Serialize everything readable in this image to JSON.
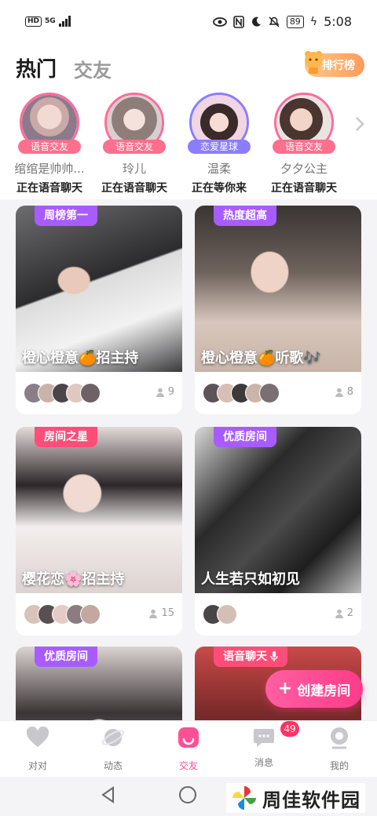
{
  "status_bar": {
    "hd": "HD",
    "network": "5G",
    "battery": "89",
    "time": "5:08"
  },
  "header": {
    "tabs": [
      {
        "label": "热门",
        "active": true
      },
      {
        "label": "交友",
        "active": false
      }
    ],
    "rank_button": "排行榜"
  },
  "stories": [
    {
      "badge": "语音交友",
      "badge_color": "#ff6f8e",
      "name": "绾绾是帅帅...",
      "status": "正在语音聊天"
    },
    {
      "badge": "语音交友",
      "badge_color": "#ff6f8e",
      "name": "玲儿",
      "status": "正在语音聊天"
    },
    {
      "badge": "恋爱星球",
      "badge_color": "#8b7dff",
      "name": "温柔",
      "status": "正在等你来"
    },
    {
      "badge": "语音交友",
      "badge_color": "#ff6f8e",
      "name": "夕夕公主",
      "status": "正在语音聊天"
    }
  ],
  "rooms": [
    {
      "tag": "周榜第一",
      "tag_color": "#a85cff",
      "title": "橙心橙意🍊招主持",
      "count": "9"
    },
    {
      "tag": "热度超高",
      "tag_color": "#a85cff",
      "title": "橙心橙意🍊听歌🎶",
      "count": "8"
    },
    {
      "tag": "房间之星",
      "tag_color": "#ff4d7a",
      "title": "樱花恋🌸招主持",
      "count": "15"
    },
    {
      "tag": "优质房间",
      "tag_color": "#a85cff",
      "title": "人生若只如初见",
      "count": "2"
    },
    {
      "tag": "优质房间",
      "tag_color": "#a85cff",
      "title": "",
      "count": ""
    },
    {
      "tag": "语音聊天",
      "tag_color": "#ff4d7a",
      "title": "",
      "count": ""
    }
  ],
  "create_button": "创建房间",
  "bottom_nav": [
    {
      "label": "对对",
      "icon": "heart-icon",
      "active": false
    },
    {
      "label": "动态",
      "icon": "planet-icon",
      "active": false
    },
    {
      "label": "交友",
      "icon": "smile-icon",
      "active": true
    },
    {
      "label": "消息",
      "icon": "chat-icon",
      "active": false,
      "badge": "49"
    },
    {
      "label": "我的",
      "icon": "profile-icon",
      "active": false
    }
  ],
  "watermark": "周佳软件园",
  "colors": {
    "accent": "#ff4f95",
    "inactive": "#c7c7cc"
  }
}
